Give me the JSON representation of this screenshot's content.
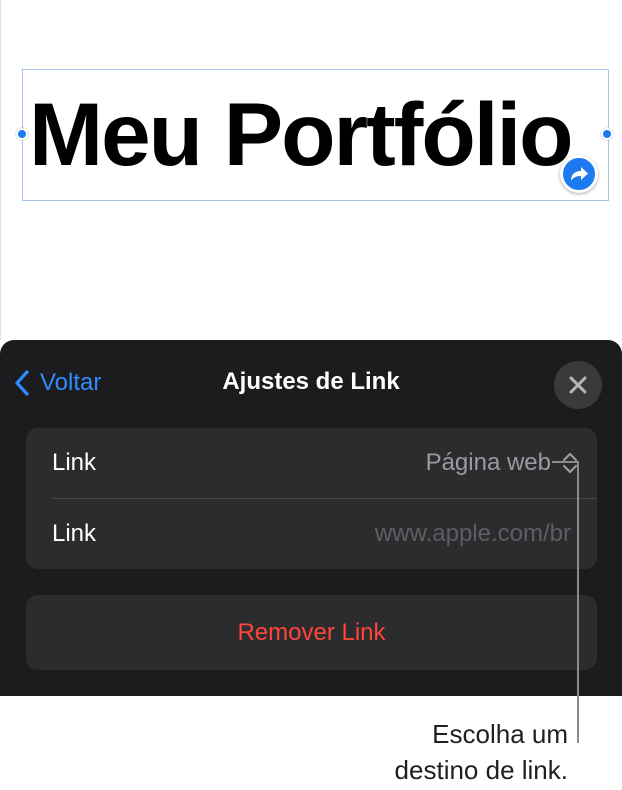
{
  "document": {
    "title": "Meu Portfólio"
  },
  "sheet": {
    "back_label": "Voltar",
    "title": "Ajustes de Link",
    "close_icon": "xmark-icon",
    "rows": [
      {
        "label": "Link",
        "value": "Página web",
        "icon": "chevron-up-down-icon"
      },
      {
        "label": "Link",
        "placeholder": "www.apple.com/br"
      }
    ],
    "remove_label": "Remover Link"
  },
  "callout": {
    "line1": "Escolha um",
    "line2": "destino de link."
  },
  "colors": {
    "accent": "#1e7af0",
    "sheet_background": "#1c1c1e",
    "group_background": "#2c2c2e",
    "destructive": "#ff453a"
  }
}
